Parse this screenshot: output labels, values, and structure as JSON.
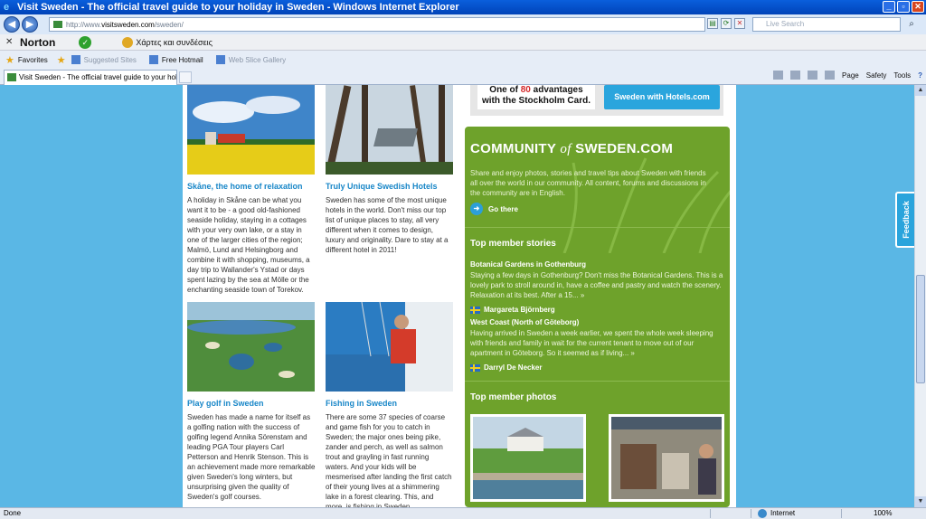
{
  "window": {
    "title": "Visit Sweden - The official travel guide to your holiday in Sweden - Windows Internet Explorer"
  },
  "address": {
    "url_prefix": "http://www.",
    "url_domain": "visitsweden.com",
    "url_suffix": "/sweden/",
    "search_placeholder": "Live Search"
  },
  "norton": {
    "brand": "Norton",
    "maps_label": "Χάρτες και συνδέσεις"
  },
  "favorites": {
    "label": "Favorites",
    "items": [
      "Suggested Sites",
      "Free Hotmail",
      "Web Slice Gallery"
    ]
  },
  "tab": {
    "title": "Visit Sweden - The official travel guide to your holiday..."
  },
  "command_bar": {
    "page": "Page",
    "safety": "Safety",
    "tools": "Tools"
  },
  "articles": [
    {
      "title": "Skåne, the home of relaxation",
      "text": "A holiday in Skåne can be what you want it to be - a good old-fashioned seaside holiday, staying in a cottages with your very own lake, or a stay in one of the larger cities of the region; Malmö, Lund and Helsingborg and combine it with shopping, museums, a day trip to Wallander's Ystad or days spent lazing by the sea at Mölle or the enchanting seaside town of Torekov."
    },
    {
      "title": "Truly Unique Swedish Hotels",
      "text": "Sweden has some of the most unique hotels in the world. Don't miss our top list of unique places to stay, all very different when it comes to design, luxury and originality. Dare to stay at a different hotel in 2011!"
    },
    {
      "title": "Play golf in Sweden",
      "text": "Sweden has made a name for itself as a golfing nation with the success of golfing legend Annika Sörenstam and leading PGA Tour players Carl Petterson and Henrik Stenson. This is an achievement made more remarkable given Sweden's long winters, but unsurprising given the quality of Sweden's golf courses."
    },
    {
      "title": "Fishing in Sweden",
      "text": "There are some 37 species of coarse and game fish for you to catch in Sweden; the major ones being pike, zander and perch, as well as salmon trout and grayling in fast running waters. And your kids will be mesmerised after landing the first catch of their young lives at a shimmering lake in a forest clearing. This, and more, is fishing in Sweden."
    }
  ],
  "banner": {
    "left_line1_pre": "One of ",
    "left_line1_num": "80",
    "left_line1_post": " advantages",
    "left_line2": "with the Stockholm Card.",
    "right": "Sweden with Hotels.com"
  },
  "community": {
    "title_pre": "COMMUNITY",
    "title_of": "of",
    "title_post": "SWEDEN.COM",
    "description": "Share and enjoy photos, stories and travel tips about Sweden with friends all over the world in our community. All content, forums and discussions in the community are in English.",
    "go_there": "Go there",
    "stories_heading": "Top member stories",
    "stories": [
      {
        "title": "Botanical Gardens in Gothenburg",
        "body": "Staying a few days in Gothenburg? Don't miss the Botanical Gardens. This is a lovely park to stroll around in, have a coffee and pastry and watch the scenery. Relaxation at its best. After a 15... »",
        "author": "Margareta Björnberg"
      },
      {
        "title": "West Coast (North of Göteborg)",
        "body": "Having arrived in Sweden a week earlier, we spent the whole week sleeping with friends and family in wait for the current tenant to move out of our apartment in Göteborg. So it seemed as if living... »",
        "author": "Darryl De Necker"
      }
    ],
    "photos_heading": "Top member photos"
  },
  "feedback": "Feedback",
  "status": {
    "text": "Done",
    "zone": "Internet",
    "zoom": "100%"
  }
}
